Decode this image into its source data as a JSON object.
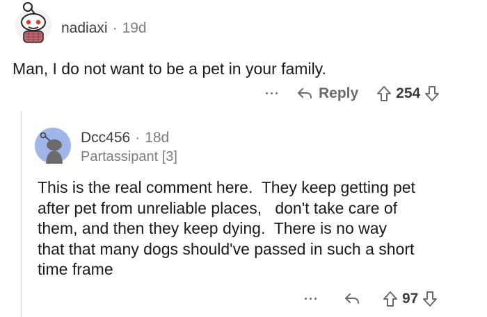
{
  "comment": {
    "author": "nadiaxi",
    "separator": "·",
    "age": "19d",
    "body": "Man, I do not want to be a pet in your family.",
    "more_label": "···",
    "reply_label": "Reply",
    "score": "254",
    "icons": {
      "reply": "reply-arrow-icon",
      "upvote": "upvote-arrow-icon",
      "downvote": "downvote-arrow-icon"
    }
  },
  "reply": {
    "author": "Dcc456",
    "separator": "·",
    "age": "18d",
    "flair": "Partassipant [3]",
    "body_lines": [
      "This is the real comment here.  They keep getting pet",
      "after pet from unreliable places,   don't take care of",
      "them, and then they keep dying.  There is no way",
      "that that many dogs should've passed in such a short",
      "time frame"
    ],
    "more_label": "···",
    "score": "97"
  },
  "colors": {
    "avatar_blue": "#a0b6e8",
    "accent_red": "#e03c2d"
  }
}
